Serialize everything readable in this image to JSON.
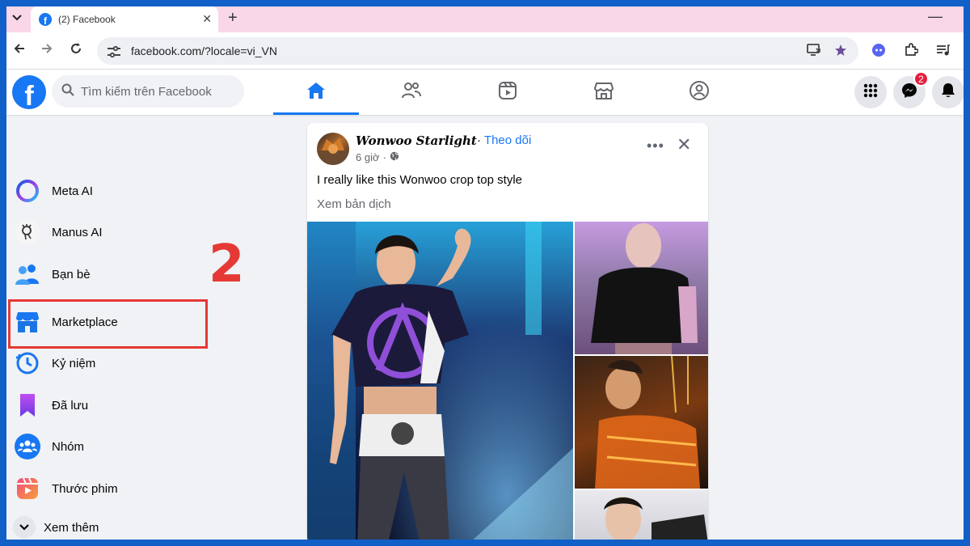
{
  "browser": {
    "tab_title": "(2) Facebook",
    "new_tab_symbol": "+",
    "close_symbol": "✕",
    "minimize_symbol": "—",
    "url": "facebook.com/?locale=vi_VN"
  },
  "fb": {
    "search_placeholder": "Tìm kiếm trên Facebook",
    "logo_letter": "f",
    "active_tab": "home",
    "messenger_badge": "2",
    "brand_color": "#1877f2"
  },
  "sidebar": {
    "items": [
      {
        "label": "Meta AI",
        "icon": "meta-ai-icon"
      },
      {
        "label": "Manus AI",
        "icon": "manus-ai-icon"
      },
      {
        "label": "Bạn bè",
        "icon": "friends-icon"
      },
      {
        "label": "Marketplace",
        "icon": "marketplace-icon"
      },
      {
        "label": "Kỷ niệm",
        "icon": "memories-icon"
      },
      {
        "label": "Đã lưu",
        "icon": "saved-icon"
      },
      {
        "label": "Nhóm",
        "icon": "groups-icon"
      },
      {
        "label": "Thước phim",
        "icon": "reels-icon"
      },
      {
        "label": "Xem thêm",
        "icon": "chevron-down-icon"
      }
    ]
  },
  "annotation": {
    "step_number": "2",
    "color": "#e53935"
  },
  "post": {
    "author": "Wonwoo Starlight",
    "separator": "·",
    "follow": "Theo dõi",
    "time": "6 giờ",
    "text": "I really like this Wonwoo crop top style",
    "translate": "Xem bản dịch",
    "more_symbol": "•••",
    "close_symbol": "✕"
  }
}
